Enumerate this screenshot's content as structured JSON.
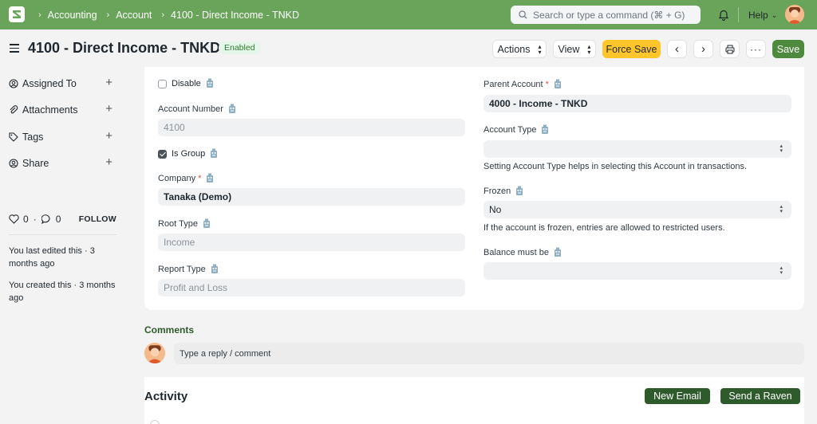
{
  "navbar": {
    "breadcrumbs": [
      "Accounting",
      "Account",
      "4100 - Direct Income - TNKD"
    ],
    "search_placeholder": "Search or type a command (⌘ + G)",
    "help_label": "Help"
  },
  "page": {
    "title": "4100 - Direct Income - TNKD",
    "status_badge": "Enabled",
    "actions_label": "Actions",
    "view_label": "View",
    "force_save_label": "Force Save",
    "save_label": "Save"
  },
  "sidebar": {
    "items": [
      {
        "label": "Assigned To",
        "icon": "assign-icon"
      },
      {
        "label": "Attachments",
        "icon": "paperclip-icon"
      },
      {
        "label": "Tags",
        "icon": "tag-icon"
      },
      {
        "label": "Share",
        "icon": "share-icon"
      }
    ],
    "likes_count": "0",
    "comments_count": "0",
    "follow_label": "FOLLOW",
    "last_edited": "You last edited this · 3 months ago",
    "created": "You created this · 3 months ago"
  },
  "form": {
    "disable_label": "Disable",
    "disable_checked": false,
    "account_number_label": "Account Number",
    "account_number_value": "4100",
    "is_group_label": "Is Group",
    "is_group_checked": true,
    "company_label": "Company",
    "company_value": "Tanaka (Demo)",
    "root_type_label": "Root Type",
    "root_type_value": "Income",
    "report_type_label": "Report Type",
    "report_type_value": "Profit and Loss",
    "parent_account_label": "Parent Account",
    "parent_account_value": "4000 - Income - TNKD",
    "account_type_label": "Account Type",
    "account_type_value": "",
    "account_type_help": "Setting Account Type helps in selecting this Account in transactions.",
    "frozen_label": "Frozen",
    "frozen_value": "No",
    "frozen_help": "If the account is frozen, entries are allowed to restricted users.",
    "balance_label": "Balance must be",
    "balance_value": "",
    "required_marker": "*"
  },
  "comments": {
    "title": "Comments",
    "placeholder": "Type a reply / comment"
  },
  "activity": {
    "title": "Activity",
    "new_email_label": "New Email",
    "send_raven_label": "Send a Raven"
  },
  "colors": {
    "navbar": "#6aa35a",
    "save_button": "#4e8a3e",
    "force_save": "#ffc52a",
    "dark_green": "#2f5a2b"
  }
}
